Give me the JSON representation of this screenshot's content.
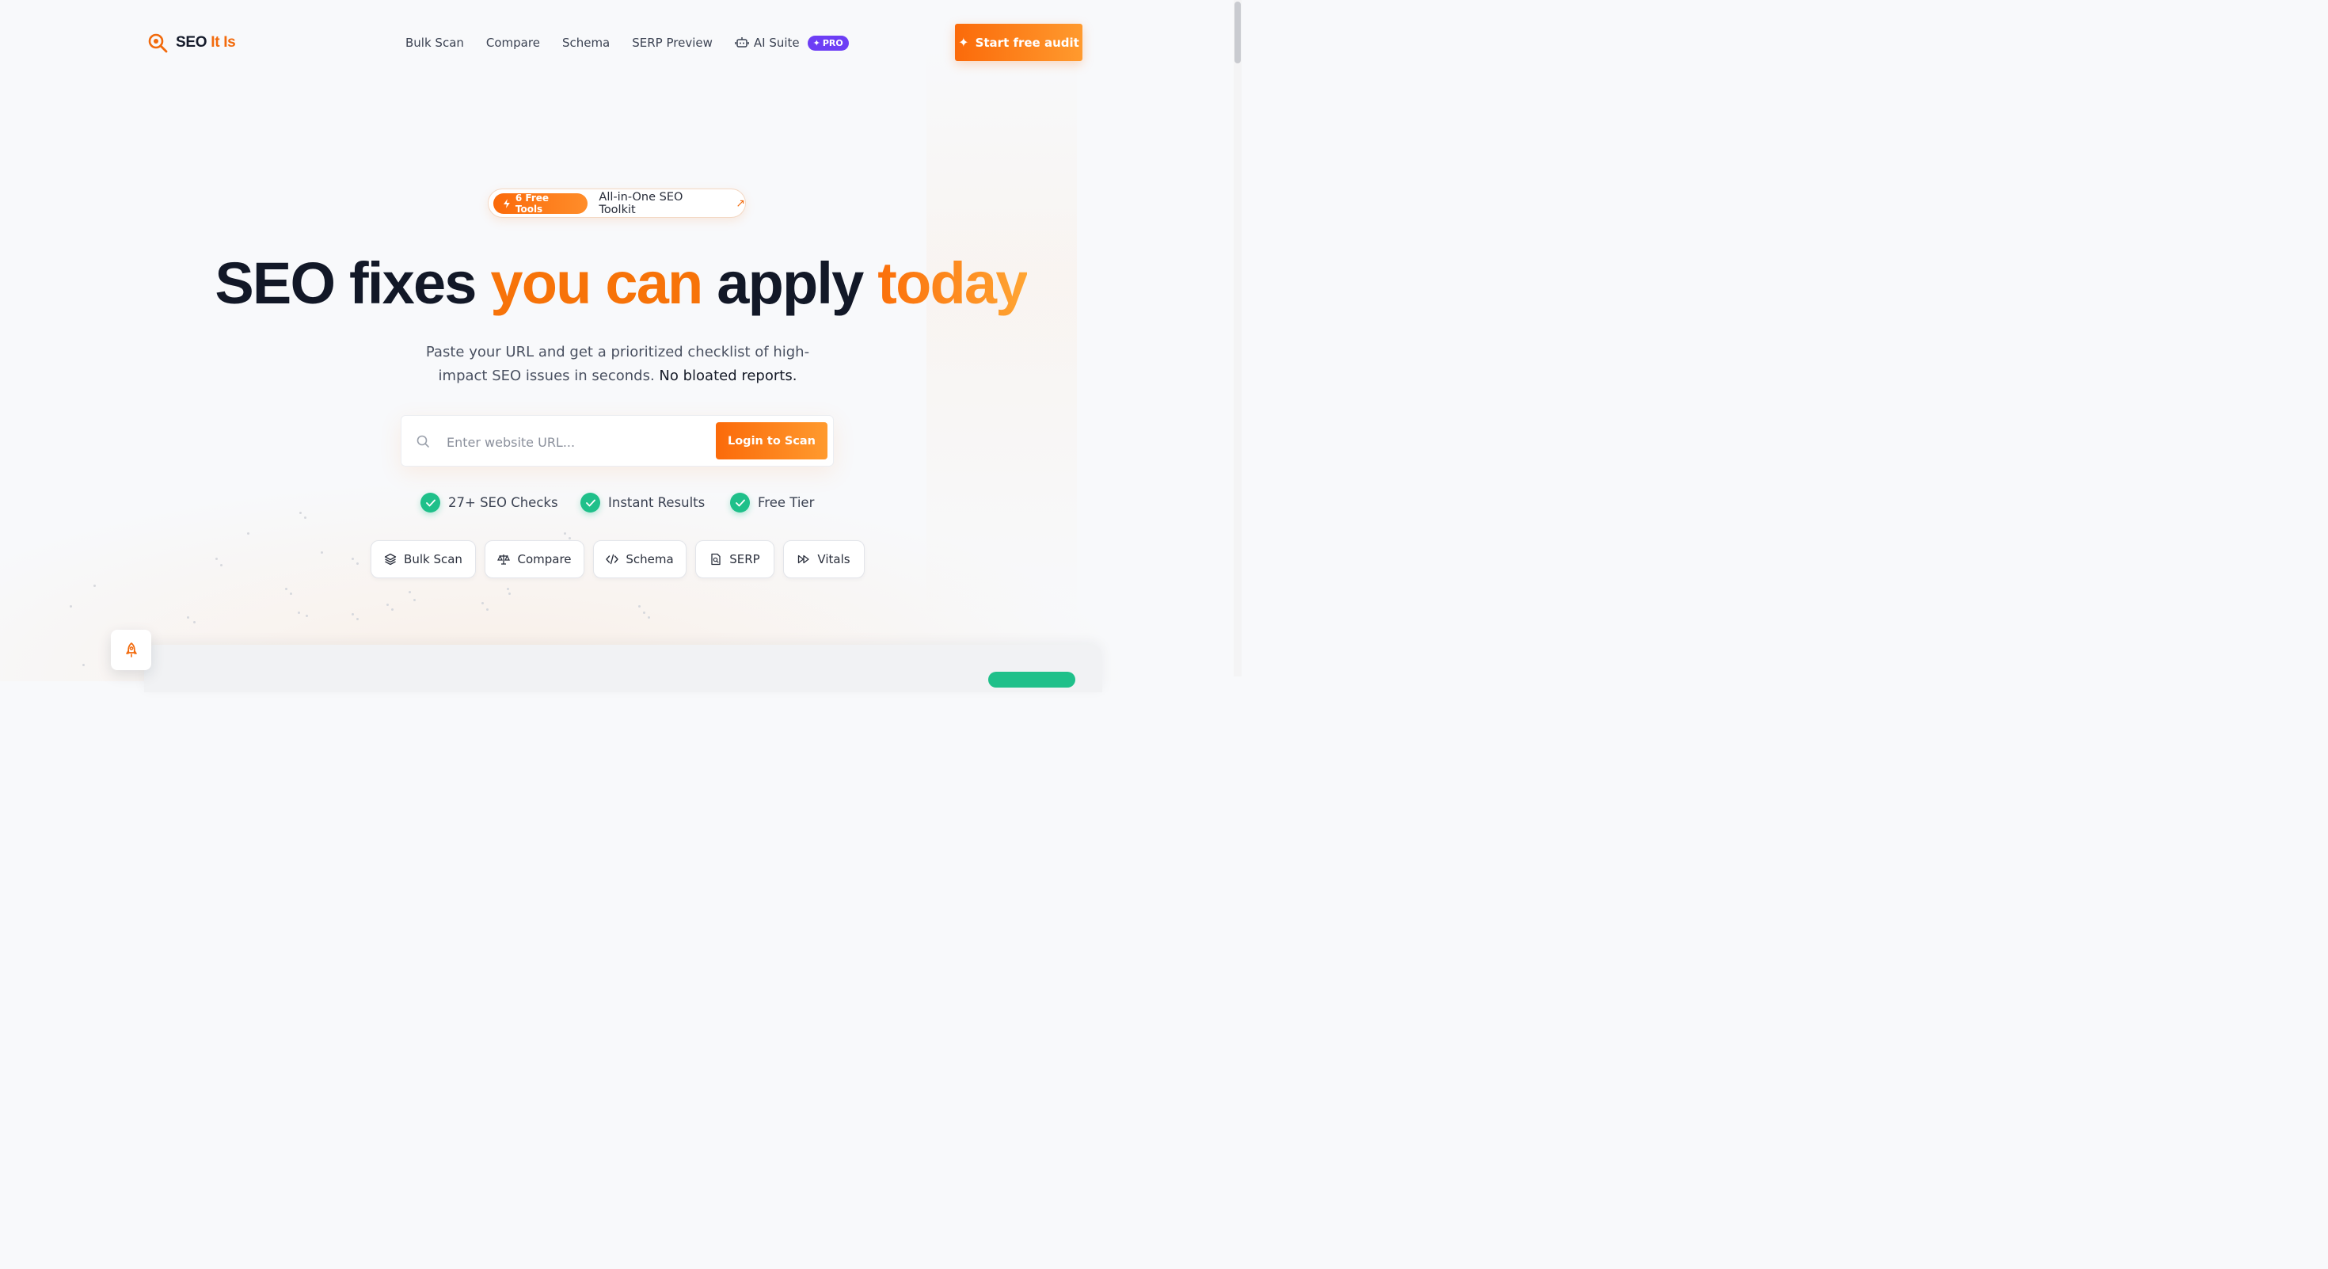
{
  "brand": {
    "name_part1": "SEO",
    "name_part2": "It Is"
  },
  "nav": {
    "items": [
      {
        "label": "Bulk Scan"
      },
      {
        "label": "Compare"
      },
      {
        "label": "Schema"
      },
      {
        "label": "SERP Preview"
      },
      {
        "label": "AI Suite",
        "badge": "PRO"
      }
    ],
    "cta_label": "Start free audit"
  },
  "hero": {
    "pill_tag": "6 Free Tools",
    "pill_text": "All-in-One SEO Toolkit",
    "headline_1": "SEO fixes ",
    "headline_2": "you can",
    "headline_3": " apply ",
    "headline_4": "today",
    "sub_text": "Paste your URL and get a prioritized checklist of high-impact SEO issues in seconds.",
    "sub_bold": "No bloated reports."
  },
  "search": {
    "placeholder": "Enter website URL...",
    "button_label": "Login to Scan"
  },
  "features": [
    {
      "label": "27+ SEO Checks"
    },
    {
      "label": "Instant Results"
    },
    {
      "label": "Free Tier"
    }
  ],
  "tools": [
    {
      "label": "Bulk Scan",
      "icon": "layers-icon"
    },
    {
      "label": "Compare",
      "icon": "scale-icon"
    },
    {
      "label": "Schema",
      "icon": "code-icon"
    },
    {
      "label": "SERP",
      "icon": "search-doc-icon"
    },
    {
      "label": "Vitals",
      "icon": "fast-forward-icon"
    }
  ],
  "colors": {
    "accent": "#fb6a0a",
    "accent_end": "#ff9a2e",
    "success": "#1fc08a",
    "pro": "#6d3ef5",
    "ink": "#121827"
  }
}
